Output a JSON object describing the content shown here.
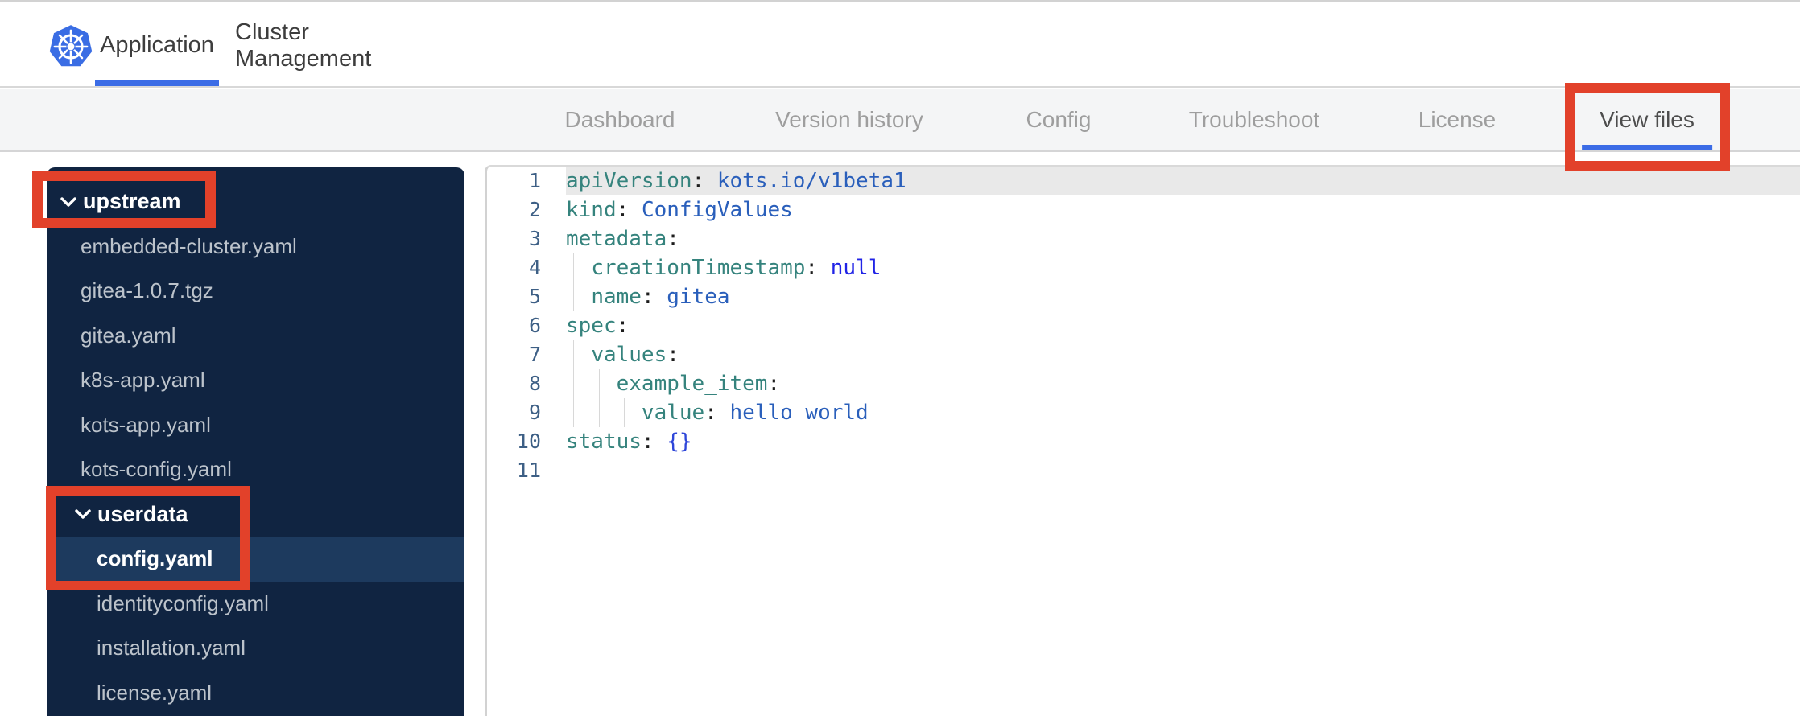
{
  "theme": {
    "annotation_red": "#e2412a",
    "active_tab_blue": "#3b6ce6",
    "kubernetes_blue": "#3a6de4",
    "sidebar_navy": "#102441",
    "sidebar_selected_navy": "#1d3a5e"
  },
  "topbar": {
    "logo_icon": "kubernetes-helm-wheel",
    "tabs": [
      {
        "label": "Application",
        "active": true
      },
      {
        "label": "Cluster Management",
        "active": false
      }
    ]
  },
  "navbar": {
    "tabs": [
      {
        "label": "Dashboard",
        "active": false
      },
      {
        "label": "Version history",
        "active": false
      },
      {
        "label": "Config",
        "active": false
      },
      {
        "label": "Troubleshoot",
        "active": false
      },
      {
        "label": "License",
        "active": false
      },
      {
        "label": "View files",
        "active": true
      }
    ]
  },
  "file_tree": {
    "items": [
      {
        "kind": "folder",
        "label": "upstream",
        "depth": 0,
        "expanded": true,
        "selected": false
      },
      {
        "kind": "file",
        "label": "embedded-cluster.yaml",
        "depth": 1,
        "selected": false
      },
      {
        "kind": "file",
        "label": "gitea-1.0.7.tgz",
        "depth": 1,
        "selected": false
      },
      {
        "kind": "file",
        "label": "gitea.yaml",
        "depth": 1,
        "selected": false
      },
      {
        "kind": "file",
        "label": "k8s-app.yaml",
        "depth": 1,
        "selected": false
      },
      {
        "kind": "file",
        "label": "kots-app.yaml",
        "depth": 1,
        "selected": false
      },
      {
        "kind": "file",
        "label": "kots-config.yaml",
        "depth": 1,
        "selected": false
      },
      {
        "kind": "folder",
        "label": "userdata",
        "depth": 1,
        "expanded": true,
        "selected": false
      },
      {
        "kind": "file",
        "label": "config.yaml",
        "depth": 2,
        "selected": true
      },
      {
        "kind": "file",
        "label": "identityconfig.yaml",
        "depth": 2,
        "selected": false
      },
      {
        "kind": "file",
        "label": "installation.yaml",
        "depth": 2,
        "selected": false
      },
      {
        "kind": "file",
        "label": "license.yaml",
        "depth": 2,
        "selected": false
      }
    ]
  },
  "editor": {
    "language": "yaml",
    "active_line": 1,
    "lines": [
      {
        "n": 1,
        "tokens": [
          [
            "key",
            "apiVersion"
          ],
          [
            "punct",
            ": "
          ],
          [
            "val",
            "kots.io/v1beta1"
          ]
        ]
      },
      {
        "n": 2,
        "tokens": [
          [
            "key",
            "kind"
          ],
          [
            "punct",
            ": "
          ],
          [
            "val",
            "ConfigValues"
          ]
        ]
      },
      {
        "n": 3,
        "tokens": [
          [
            "key",
            "metadata"
          ],
          [
            "punct",
            ":"
          ]
        ]
      },
      {
        "n": 4,
        "tokens": [
          [
            "ws",
            "  "
          ],
          [
            "key",
            "creationTimestamp"
          ],
          [
            "punct",
            ": "
          ],
          [
            "atom",
            "null"
          ]
        ]
      },
      {
        "n": 5,
        "tokens": [
          [
            "ws",
            "  "
          ],
          [
            "key",
            "name"
          ],
          [
            "punct",
            ": "
          ],
          [
            "val",
            "gitea"
          ]
        ]
      },
      {
        "n": 6,
        "tokens": [
          [
            "key",
            "spec"
          ],
          [
            "punct",
            ":"
          ]
        ]
      },
      {
        "n": 7,
        "tokens": [
          [
            "ws",
            "  "
          ],
          [
            "key",
            "values"
          ],
          [
            "punct",
            ":"
          ]
        ]
      },
      {
        "n": 8,
        "tokens": [
          [
            "ws",
            "    "
          ],
          [
            "key",
            "example_item"
          ],
          [
            "punct",
            ":"
          ]
        ]
      },
      {
        "n": 9,
        "tokens": [
          [
            "ws",
            "      "
          ],
          [
            "key",
            "value"
          ],
          [
            "punct",
            ": "
          ],
          [
            "val",
            "hello world"
          ]
        ]
      },
      {
        "n": 10,
        "tokens": [
          [
            "key",
            "status"
          ],
          [
            "punct",
            ": "
          ],
          [
            "brace",
            "{}"
          ]
        ]
      },
      {
        "n": 11,
        "tokens": []
      }
    ]
  },
  "annotations": {
    "color": "#e2412a",
    "boxes": [
      {
        "target": "upstream-folder"
      },
      {
        "target": "userdata-folder-and-config-yaml"
      },
      {
        "target": "view-files-tab"
      }
    ]
  }
}
